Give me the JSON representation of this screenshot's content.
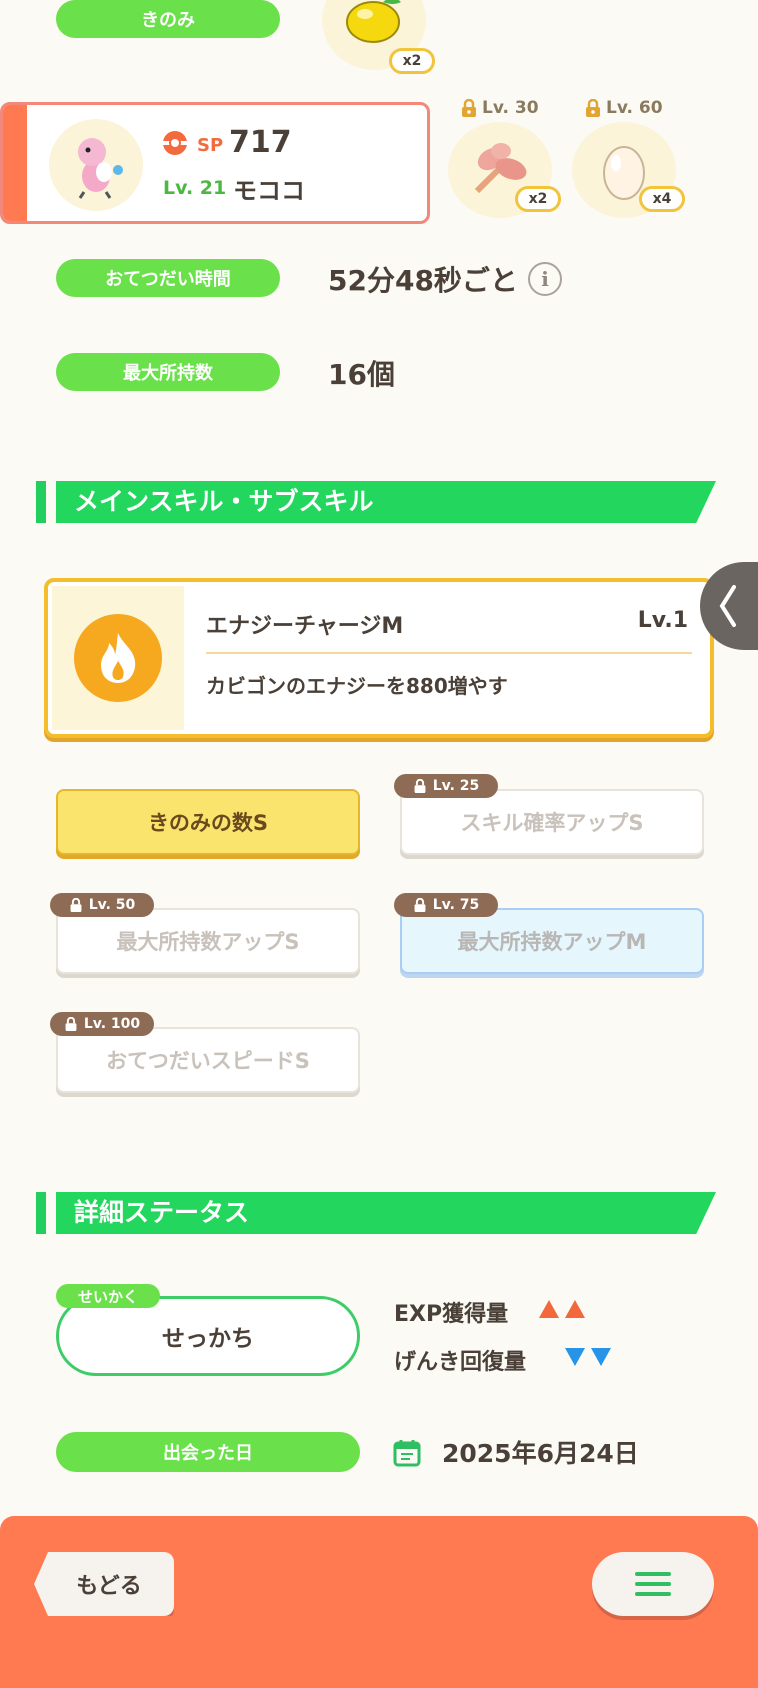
{
  "berry": {
    "label": "きのみ",
    "item_icon": "lemon-berry-icon",
    "count": "x2"
  },
  "pokemon_card": {
    "sp_label": "SP",
    "sp_value": "717",
    "level": "Lv. 21",
    "name": "モココ",
    "avatar": "flaaffy-avatar"
  },
  "ingredients": [
    {
      "lv": "Lv. 30",
      "icon": "cinnamon-leaf-icon",
      "count": "x2"
    },
    {
      "lv": "Lv. 60",
      "icon": "egg-icon",
      "count": "x4"
    }
  ],
  "help_time": {
    "label": "おてつだい時間",
    "value": "52分48秒ごと"
  },
  "max_carry": {
    "label": "最大所持数",
    "value": "16個"
  },
  "skills_section": {
    "title": "メインスキル・サブスキル"
  },
  "main_skill": {
    "name": "エナジーチャージM",
    "level": "Lv.1",
    "desc": "カビゴンのエナジーを880増やす",
    "icon": "fire-icon"
  },
  "sub_skills": [
    {
      "label": "きのみの数S",
      "lv": ""
    },
    {
      "label": "スキル確率アップS",
      "lv": "Lv. 25"
    },
    {
      "label": "最大所持数アップS",
      "lv": "Lv. 50"
    },
    {
      "label": "最大所持数アップM",
      "lv": "Lv. 75"
    },
    {
      "label": "おてつだいスピードS",
      "lv": "Lv. 100"
    }
  ],
  "detail_section": {
    "title": "詳細ステータス"
  },
  "nature": {
    "tag": "せいかく",
    "value": "せっかち",
    "up_label": "EXP獲得量",
    "down_label": "げんき回復量"
  },
  "met_date": {
    "label": "出会った日",
    "value": "2025年6月24日"
  },
  "footer": {
    "back_label": "もどる"
  },
  "colors": {
    "green": "#6ae04a",
    "section_green": "#22d65e",
    "footer_orange": "#ff7a50",
    "gold": "#f2c33d"
  }
}
